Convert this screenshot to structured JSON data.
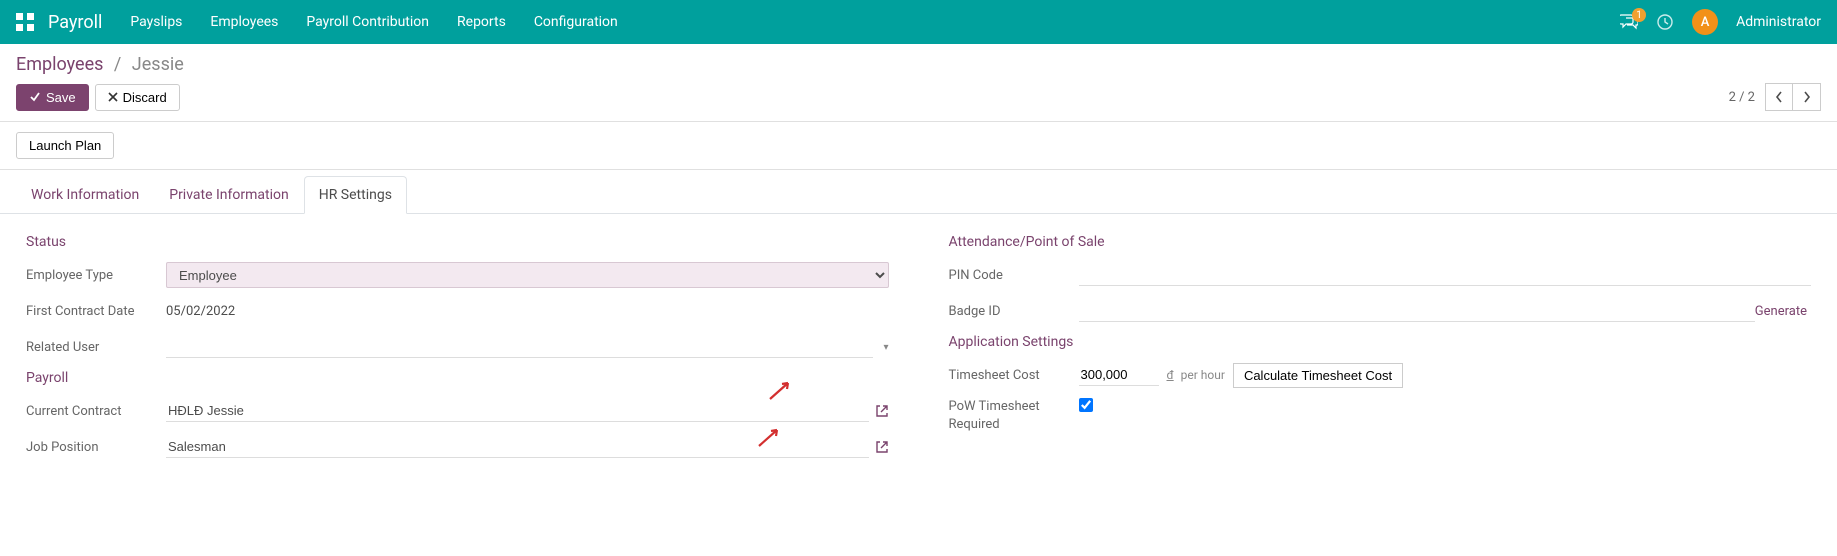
{
  "topbar": {
    "brand": "Payroll",
    "menu": [
      "Payslips",
      "Employees",
      "Payroll Contribution",
      "Reports",
      "Configuration"
    ],
    "chat_badge": "1",
    "avatar_initial": "A",
    "user_name": "Administrator"
  },
  "breadcrumb": {
    "parent": "Employees",
    "current": "Jessie"
  },
  "actions": {
    "save": "Save",
    "discard": "Discard",
    "launch_plan": "Launch Plan"
  },
  "pager": {
    "text": "2 / 2"
  },
  "tabs": {
    "work_info": "Work Information",
    "private_info": "Private Information",
    "hr_settings": "HR Settings"
  },
  "sections": {
    "status": "Status",
    "payroll": "Payroll",
    "attendance": "Attendance/Point of Sale",
    "app_settings": "Application Settings"
  },
  "fields": {
    "employee_type_label": "Employee Type",
    "employee_type_value": "Employee",
    "first_contract_date_label": "First Contract Date",
    "first_contract_date_value": "05/02/2022",
    "related_user_label": "Related User",
    "related_user_value": "",
    "current_contract_label": "Current Contract",
    "current_contract_value": "HĐLĐ Jessie",
    "job_position_label": "Job Position",
    "job_position_value": "Salesman",
    "pin_code_label": "PIN Code",
    "pin_code_value": "",
    "badge_id_label": "Badge ID",
    "badge_id_value": "",
    "generate": "Generate",
    "timesheet_cost_label": "Timesheet Cost",
    "timesheet_cost_value": "300,000",
    "per_hour": "per hour",
    "calc_timesheet": "Calculate Timesheet Cost",
    "pow_label": "PoW Timesheet Required"
  }
}
